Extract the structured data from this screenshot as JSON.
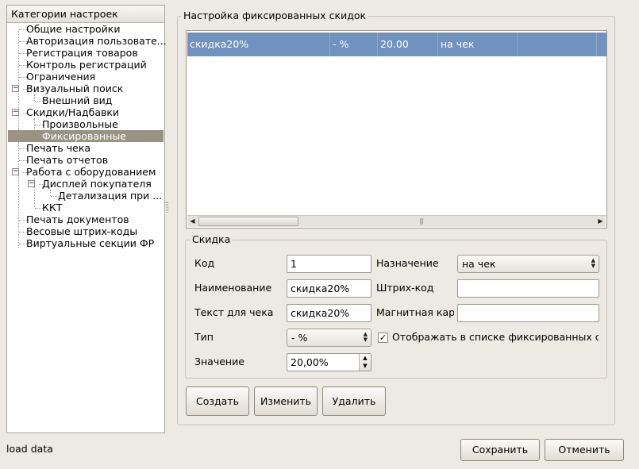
{
  "tree": {
    "header": "Категории настроек",
    "items": [
      {
        "label": "Общие настройки"
      },
      {
        "label": "Авторизация пользовате..."
      },
      {
        "label": "Регистрация товаров"
      },
      {
        "label": "Контроль регистраций"
      },
      {
        "label": "Ограничения"
      },
      {
        "label": "Визуальный поиск",
        "expander": "−"
      },
      {
        "label": "Внешний вид"
      },
      {
        "label": "Скидки/Надбавки",
        "expander": "−"
      },
      {
        "label": "Произвольные"
      },
      {
        "label": "Фиксированные"
      },
      {
        "label": "Печать чека"
      },
      {
        "label": "Печать отчетов"
      },
      {
        "label": "Работа с оборудованием",
        "expander": "−"
      },
      {
        "label": "Дисплей покупателя",
        "expander": "−"
      },
      {
        "label": "Детализация при ..."
      },
      {
        "label": "ККТ"
      },
      {
        "label": "Печать документов"
      },
      {
        "label": "Весовые штрих-коды"
      },
      {
        "label": "Виртуальные секции ФР"
      }
    ]
  },
  "fixed_group": {
    "title": "Настройка фиксированных скидок"
  },
  "table": {
    "rows": [
      {
        "name": "скидка20%",
        "type": "- %",
        "value": "20.00",
        "purpose": "на чек",
        "extra": ""
      }
    ]
  },
  "discount_group": {
    "title": "Скидка"
  },
  "form": {
    "code_label": "Код",
    "code_value": "1",
    "name_label": "Наименование",
    "name_value": "скидка20%",
    "receipt_text_label": "Текст для чека",
    "receipt_text_value": "скидка20%",
    "type_label": "Тип",
    "type_value": "- %",
    "value_label": "Значение",
    "value_value": "20,00%",
    "purpose_label": "Назначение",
    "purpose_value": "на чек",
    "barcode_label": "Штрих-код",
    "barcode_value": "",
    "magnetic_label": "Магнитная кар",
    "magnetic_value": "",
    "show_in_list_label": "Отображать в списке фиксированных ск",
    "show_in_list_checked": true,
    "checkmark": "✓"
  },
  "buttons": {
    "create": "Создать",
    "edit": "Изменить",
    "delete": "Удалить",
    "save": "Сохранить",
    "cancel": "Отменить"
  },
  "status": {
    "text": "load data"
  }
}
